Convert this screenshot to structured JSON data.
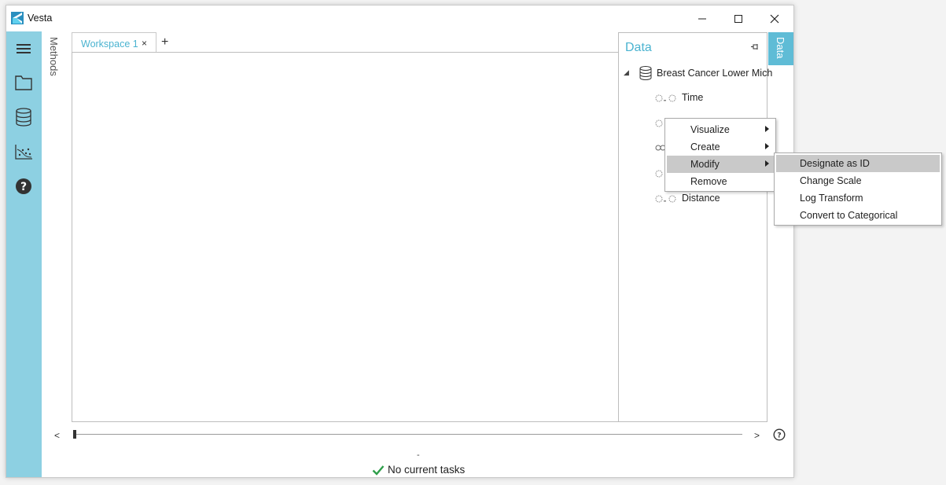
{
  "window": {
    "title": "Vesta",
    "controls": {
      "minimize": "minimize",
      "maximize": "maximize",
      "close": "close"
    }
  },
  "left_rail": {
    "items": [
      {
        "icon": "hamburger-menu-icon"
      },
      {
        "icon": "folder-icon"
      },
      {
        "icon": "database-icon"
      },
      {
        "icon": "chart-icon"
      },
      {
        "icon": "help-icon"
      }
    ]
  },
  "methods_panel": {
    "label": "Methods"
  },
  "workspace_tabs": [
    {
      "label": "Workspace 1",
      "close": "×"
    }
  ],
  "add_tab": "+",
  "data_panel": {
    "title": "Data",
    "dataset": "Breast Cancer Lower Mich",
    "variables": [
      "Time",
      "",
      "",
      "",
      "Distance"
    ]
  },
  "data_side_tab": {
    "label": "Data"
  },
  "context_menu": {
    "items": [
      {
        "label": "Visualize",
        "submenu": true
      },
      {
        "label": "Create",
        "submenu": true
      },
      {
        "label": "Modify",
        "submenu": true,
        "highlighted": true
      },
      {
        "label": "Remove",
        "submenu": false
      }
    ]
  },
  "submenu": {
    "items": [
      {
        "label": "Designate as ID",
        "highlighted": true
      },
      {
        "label": "Change Scale"
      },
      {
        "label": "Log Transform"
      },
      {
        "label": "Convert to Categorical"
      }
    ]
  },
  "timeline": {
    "prev": "<",
    "next": ">"
  },
  "status": {
    "separator": "-",
    "tasks": "No current tasks"
  },
  "colors": {
    "accent": "#4ab3d0",
    "rail": "#8dd0e2",
    "side_tab": "#5fbcd6",
    "check": "#2e9e4a"
  }
}
